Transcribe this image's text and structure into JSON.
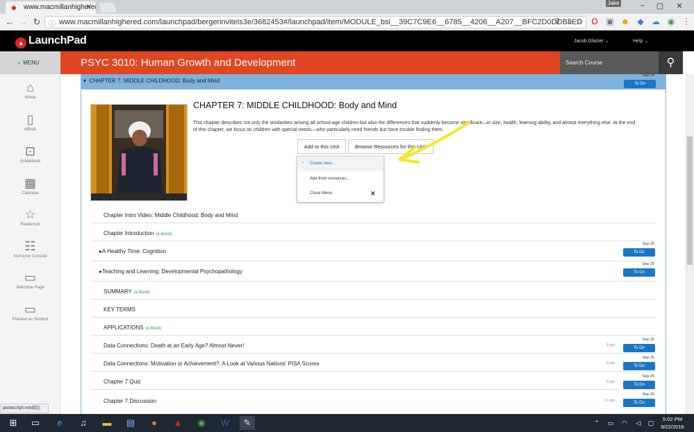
{
  "browser": {
    "tab_title": "www.macmillanhighered",
    "url": "www.macmillanhighered.com/launchpad/bergerinvitels3e/3682453#/launchpad/item/MODULE_bsi__39C7C9E6__6785__4206__A207__BFC2D0DDB9ED",
    "user": "Jake"
  },
  "app": {
    "brand": "LaunchPad",
    "user_menu": "Jacob Glazier ⌄",
    "help_menu": "Help ⌄",
    "menu_label": "MENU",
    "course_title": "PSYC 3010: Human Growth and Development",
    "search_placeholder": "Search Course"
  },
  "sidebar": {
    "items": [
      {
        "label": "Home"
      },
      {
        "label": "eBook"
      },
      {
        "label": "Gradebook"
      },
      {
        "label": "Calendar"
      },
      {
        "label": "Resources"
      },
      {
        "label": "Instructor Console"
      },
      {
        "label": "Welcome Page"
      },
      {
        "label": "Preview as Student"
      }
    ]
  },
  "chapter": {
    "bar_title": "CHAPTER 7: MIDDLE CHILDHOOD: Body and Mind",
    "due": "Sep 25",
    "todo": "To Do",
    "heading": "CHAPTER 7: MIDDLE CHILDHOOD: Body and Mind",
    "description": "This chapter describes not only the similarities among all school-age children but also the differences that suddenly become significant—in size, health, learning ability, and almost everything else. At the end of this chapter, we focus on children with special needs—who particularly need friends but have trouble finding them.",
    "add_button": "Add to this Unit",
    "browse_button": "Browse Resources for this Unit",
    "dropdown": {
      "create": "Create new...",
      "add_from": "Add from resources...",
      "close": "Close Menu"
    }
  },
  "items": [
    {
      "title": "Chapter Intro Video: Middle Childhood: Body and Mind",
      "tag": "",
      "pts": "",
      "due": "",
      "todo": ""
    },
    {
      "title": "Chapter Introduction",
      "tag": "(e-Book)",
      "pts": "",
      "due": "",
      "todo": ""
    },
    {
      "title": "▸A Healthy Time: Cognition",
      "tag": "",
      "pts": "",
      "due": "Sep 25",
      "todo": "To Do"
    },
    {
      "title": "▸Teaching and Learning: Developmental Psychopathology",
      "tag": "",
      "pts": "",
      "due": "Sep 25",
      "todo": "To Do"
    },
    {
      "title": "SUMMARY",
      "tag": "(e-Book)",
      "pts": "",
      "due": "",
      "todo": ""
    },
    {
      "title": "KEY TERMS",
      "tag": "",
      "pts": "",
      "due": "",
      "todo": ""
    },
    {
      "title": "APPLICATIONS",
      "tag": "(e-Book)",
      "pts": "",
      "due": "",
      "todo": ""
    },
    {
      "title": "Data Connections: Death at an Early Age? Almost Never!",
      "tag": "",
      "pts": "8 pts",
      "due": "Sep 25",
      "todo": "To Do"
    },
    {
      "title": "Data Connections: Motivation or Achievement?: A Look at Various Nations' PISA Scores",
      "tag": "",
      "pts": "8 pts",
      "due": "Sep 25",
      "todo": "To Do"
    },
    {
      "title": "Chapter 7 Quiz",
      "tag": "",
      "pts": "8 pts",
      "due": "Sep 25",
      "todo": "To Do"
    },
    {
      "title": "Chapter 7 Discussion",
      "tag": "",
      "pts": "10 pts",
      "due": "Sep 25",
      "todo": "To Do"
    }
  ],
  "status_text": "javascript:void(0);",
  "clock": {
    "time": "5:02 PM",
    "date": "9/22/2016"
  }
}
